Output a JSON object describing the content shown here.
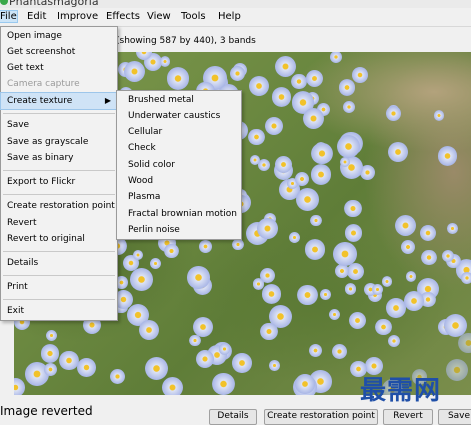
{
  "app": {
    "title": "Phantasmagoria"
  },
  "menubar": [
    "File",
    "Edit",
    "Improve",
    "Effects",
    "View",
    "Tools",
    "Help"
  ],
  "image_info": "(showing 587 by 440), 3 bands",
  "file_menu": {
    "open_image": "Open image",
    "get_screenshot": "Get screenshot",
    "get_text": "Get text",
    "camera_capture": "Camera capture",
    "create_texture": "Create texture",
    "submenu_arrow": "▶",
    "save": "Save",
    "save_grayscale": "Save as grayscale",
    "save_binary": "Save as binary",
    "export_flickr": "Export to Flickr",
    "create_restoration": "Create restoration point",
    "revert": "Revert",
    "revert_original": "Revert to original",
    "details": "Details",
    "print": "Print",
    "exit": "Exit"
  },
  "texture_menu": [
    "Brushed metal",
    "Underwater caustics",
    "Cellular",
    "Check",
    "Solid color",
    "Wood",
    "Plasma",
    "Fractal brownian motion",
    "Perlin noise"
  ],
  "status": "Image reverted",
  "buttons": {
    "details": "Details",
    "create_restoration": "Create restoration point",
    "revert": "Revert",
    "save": "Save"
  },
  "watermark": "最需网",
  "colors": {
    "menu_highlight": "#cfe3f6",
    "watermark": "#1f4fa8"
  }
}
